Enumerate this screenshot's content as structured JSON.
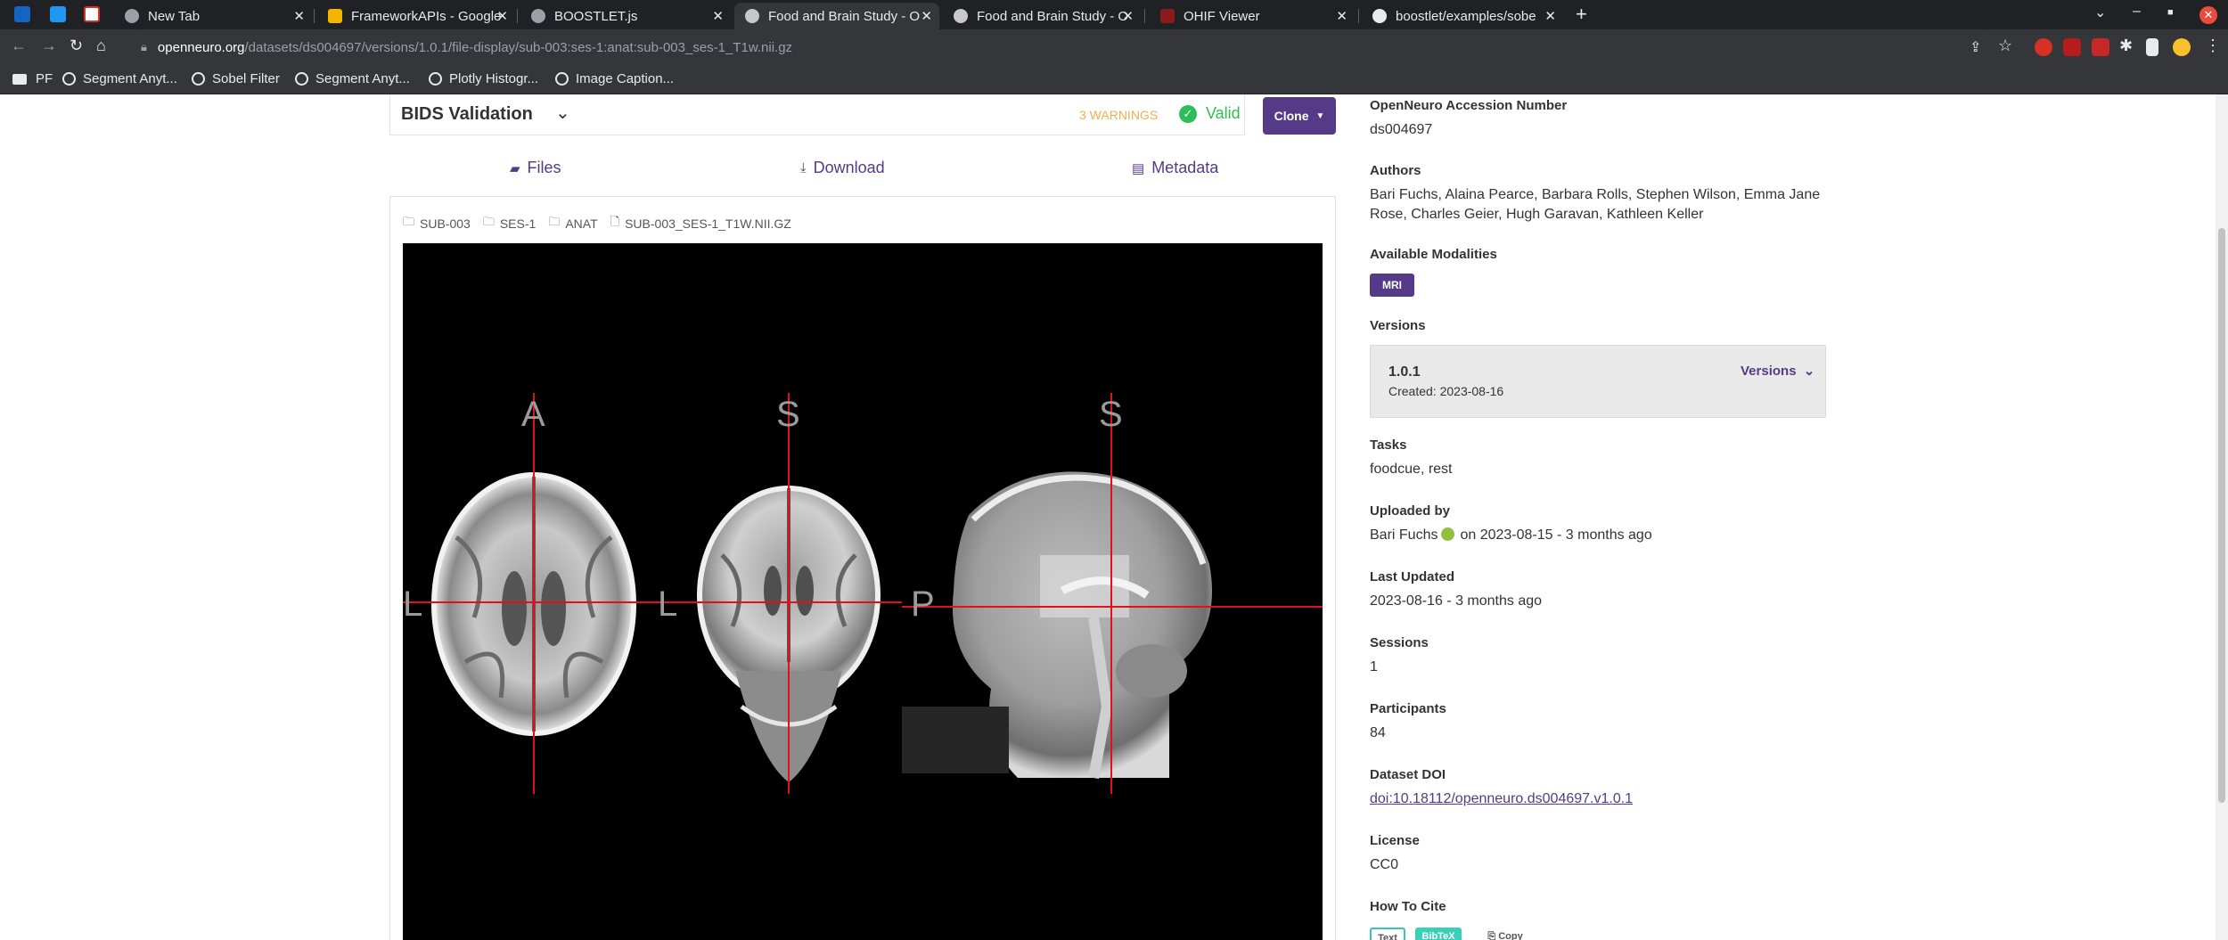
{
  "browser": {
    "tabs": [
      {
        "label": "New Tab",
        "active": false
      },
      {
        "label": "FrameworkAPIs - Google",
        "active": false
      },
      {
        "label": "BOOSTLET.js",
        "active": false
      },
      {
        "label": "Food and Brain Study - O",
        "active": true
      },
      {
        "label": "Food and Brain Study - O",
        "active": false
      },
      {
        "label": "OHIF Viewer",
        "active": false
      },
      {
        "label": "boostlet/examples/sobe",
        "active": false
      }
    ],
    "new_tab": "+",
    "url_host": "openneuro.org",
    "url_path": "/datasets/ds004697/versions/1.0.1/file-display/sub-003:ses-1:anat:sub-003_ses-1_T1w.nii.gz",
    "bookmarks": [
      "PF",
      "Segment Anyt...",
      "Sobel Filter",
      "Segment Anyt...",
      "Plotly Histogr...",
      "Image Caption..."
    ]
  },
  "bids": {
    "title": "BIDS Validation",
    "warnings": "3 WARNINGS",
    "valid": "Valid",
    "clone": "Clone"
  },
  "file_tabs": {
    "files": "Files",
    "download": "Download",
    "metadata": "Metadata"
  },
  "breadcrumbs": [
    "SUB-003",
    "SES-1",
    "ANAT",
    "SUB-003_SES-1_T1W.NII.GZ"
  ],
  "viewer": {
    "orientation_labels": {
      "axial_top": "A",
      "coronal_top": "S",
      "sagittal_top": "S",
      "axial_left": "L",
      "coronal_left": "L",
      "sagittal_left": "P"
    }
  },
  "colors": {
    "brand": "#543a87",
    "valid": "#2ebd59",
    "warning": "#f0ad4e",
    "crosshair": "#e0111c"
  },
  "meta": {
    "accession_label": "OpenNeuro Accession Number",
    "accession": "ds004697",
    "authors_label": "Authors",
    "authors_line1": "Bari Fuchs, Alaina Pearce, Barbara Rolls, Stephen Wilson, Emma Jane",
    "authors_line2": "Rose, Charles Geier, Hugh Garavan, Kathleen Keller",
    "modalities_label": "Available Modalities",
    "modality": "MRI",
    "versions_label": "Versions",
    "version": "1.0.1",
    "version_created": "Created: 2023-08-16",
    "versions_toggle": "Versions",
    "tasks_label": "Tasks",
    "tasks": "foodcue, rest",
    "uploaded_label": "Uploaded by",
    "uploader": "Bari Fuchs",
    "uploaded_date": "on 2023-08-15 - 3 months ago",
    "updated_label": "Last Updated",
    "updated": "2023-08-16 - 3 months ago",
    "sessions_label": "Sessions",
    "sessions": "1",
    "participants_label": "Participants",
    "participants": "84",
    "doi_label": "Dataset DOI",
    "doi": "doi:10.18112/openneuro.ds004697.v1.0.1",
    "license_label": "License",
    "license": "CC0",
    "cite_label": "How To Cite",
    "cite_text": "Text",
    "cite_bibtex": "BibTeX",
    "cite_copy": "Copy"
  }
}
